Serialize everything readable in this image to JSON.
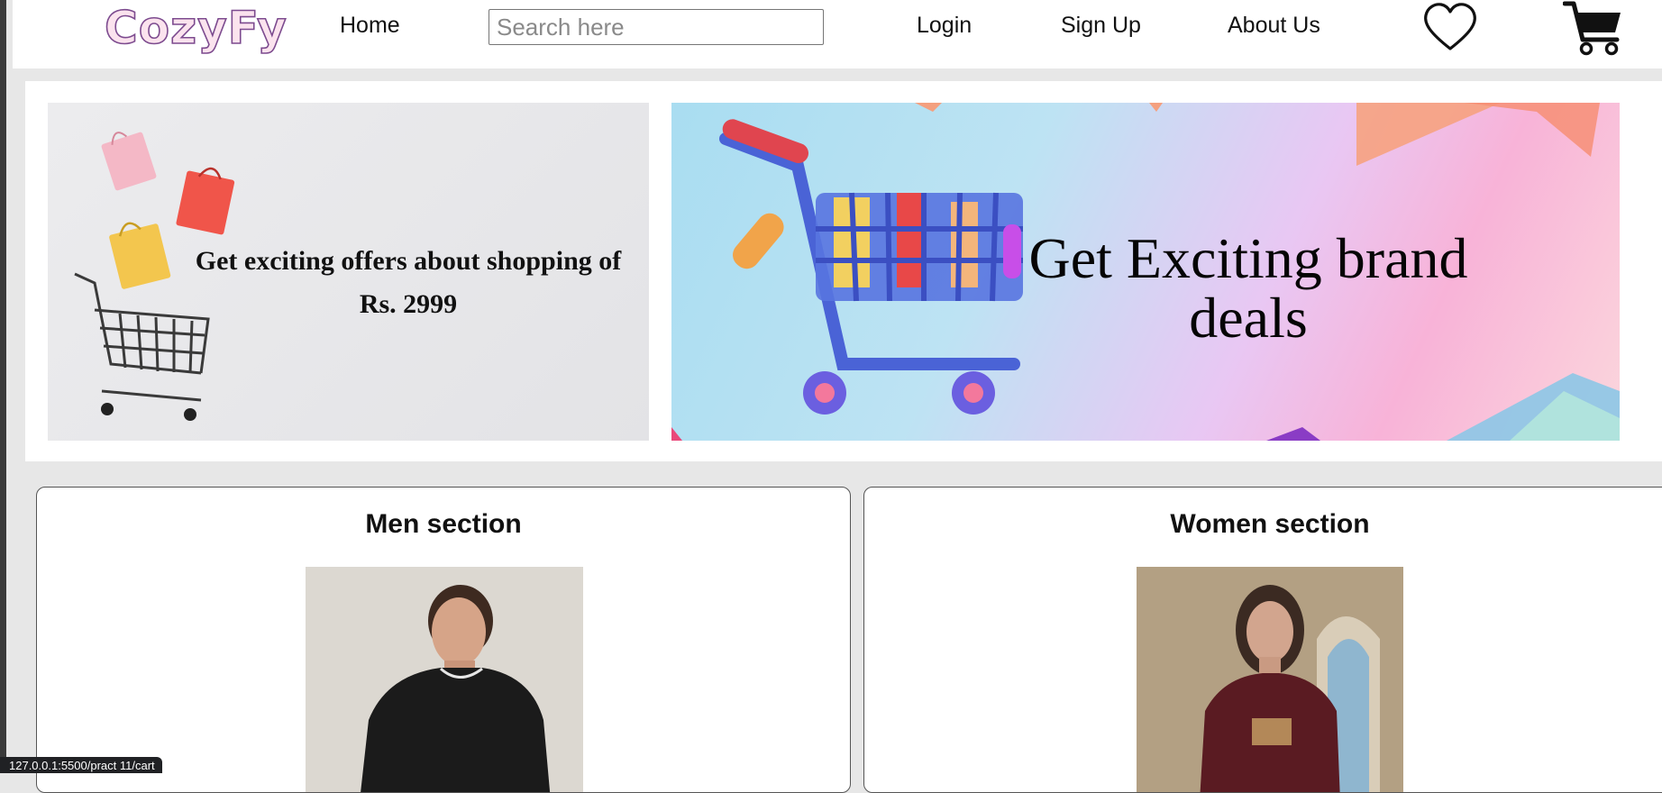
{
  "brand": {
    "logo_text": "CozyFy"
  },
  "nav": {
    "home": "Home",
    "login": "Login",
    "signup": "Sign Up",
    "about": "About Us"
  },
  "search": {
    "placeholder": "Search here",
    "value": ""
  },
  "icons": {
    "wishlist": "heart-icon",
    "cart": "cart-icon"
  },
  "banners": {
    "left_text": "Get exciting offers about shopping of Rs. 2999",
    "right_text": "Get Exciting brand deals"
  },
  "sections": {
    "men_title": "Men section",
    "women_title": "Women section"
  },
  "status_bar": {
    "url": "127.0.0.1:5500/pract 11/cart"
  },
  "colors": {
    "logo_fill": "#fbe3ee",
    "logo_outline": "#7d4b8f"
  }
}
